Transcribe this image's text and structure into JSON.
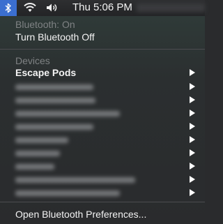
{
  "menubar": {
    "bluetooth_icon": "bluetooth-icon",
    "wifi_icon": "wifi-icon",
    "volume_icon": "volume-icon",
    "clock": "Thu 5:06 PM",
    "accent_color": "#3b6fd0"
  },
  "menu": {
    "status": "Bluetooth: On",
    "toggle_label": "Turn Bluetooth Off",
    "devices_header": "Devices",
    "first_device": "Escape Pods",
    "blurred_device_count": 9,
    "preferences_label": "Open Bluetooth Preferences..."
  }
}
